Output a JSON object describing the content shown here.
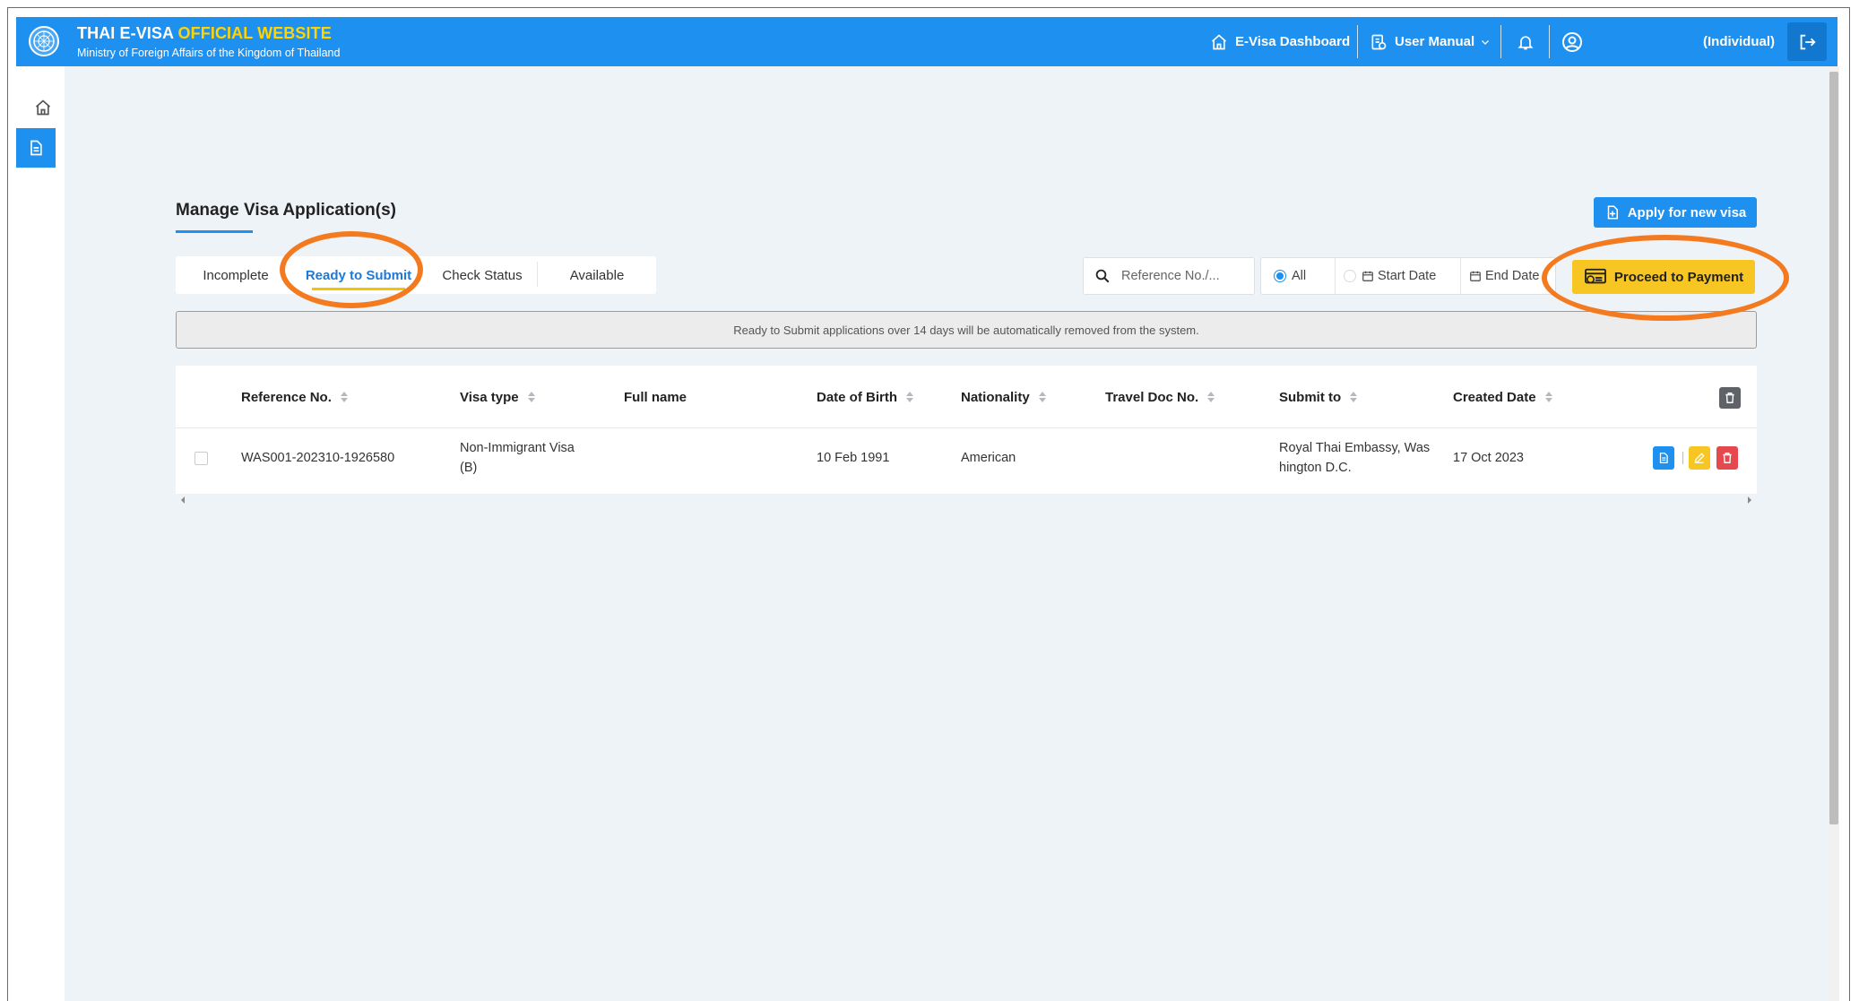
{
  "header": {
    "title_main": "THAI E-VISA ",
    "title_accent": "OFFICIAL WEBSITE",
    "subtitle": "Ministry of Foreign Affairs of the Kingdom of Thailand",
    "nav_dashboard": "E-Visa Dashboard",
    "nav_manual": "User Manual",
    "user_label": "(Individual)"
  },
  "page": {
    "title": "Manage Visa Application(s)",
    "apply_label": "Apply for new visa",
    "pay_label": "Proceed to Payment",
    "notice": "Ready to Submit applications over 14 days will be automatically removed from the system."
  },
  "tabs": [
    {
      "label": "Incomplete"
    },
    {
      "label": "Ready to Submit"
    },
    {
      "label": "Check Status"
    },
    {
      "label": "Available"
    }
  ],
  "filters": {
    "search_placeholder": "Reference No./...",
    "all_label": "All",
    "start_label": "Start Date",
    "end_label": "End Date"
  },
  "table": {
    "headers": {
      "reference": "Reference No.",
      "visa_type": "Visa type",
      "full_name": "Full name",
      "dob": "Date of Birth",
      "nationality": "Nationality",
      "travel_doc": "Travel Doc No.",
      "submit_to": "Submit to",
      "created": "Created Date"
    },
    "rows": [
      {
        "reference": "WAS001-202310-1926580",
        "visa_type": "Non-Immigrant Visa (B)",
        "full_name": "",
        "dob": "10 Feb 1991",
        "nationality": "American",
        "travel_doc": "",
        "submit_to": "Royal Thai Embassy, Washington D.C.",
        "created": "17 Oct 2023"
      }
    ]
  },
  "colors": {
    "primary": "#1e90f0",
    "accent_yellow": "#ffd400",
    "pay_button": "#f7c623",
    "highlight": "#f47a1f"
  },
  "icons": [
    "emblem-icon",
    "home-icon",
    "manual-icon",
    "bell-icon",
    "user-icon",
    "logout-icon",
    "document-icon",
    "plus-file-icon",
    "search-icon",
    "calendar-icon",
    "payment-icon",
    "trash-icon",
    "edit-icon"
  ]
}
